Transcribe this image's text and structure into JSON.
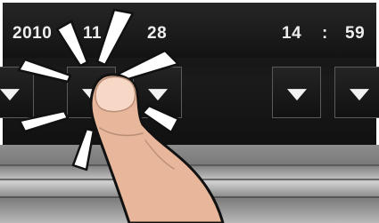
{
  "date_time_setting": {
    "year": "2010",
    "month": "11",
    "day": "28",
    "hour": "14",
    "separator": ":",
    "minute": "59"
  },
  "icons": {
    "decrement": "triangle-down-icon",
    "touch": "tapping-finger-icon",
    "burst": "tap-burst-icon"
  },
  "colors": {
    "screen": "#111111",
    "text": "#eeeeee",
    "bezel": "#9a9a9a"
  }
}
